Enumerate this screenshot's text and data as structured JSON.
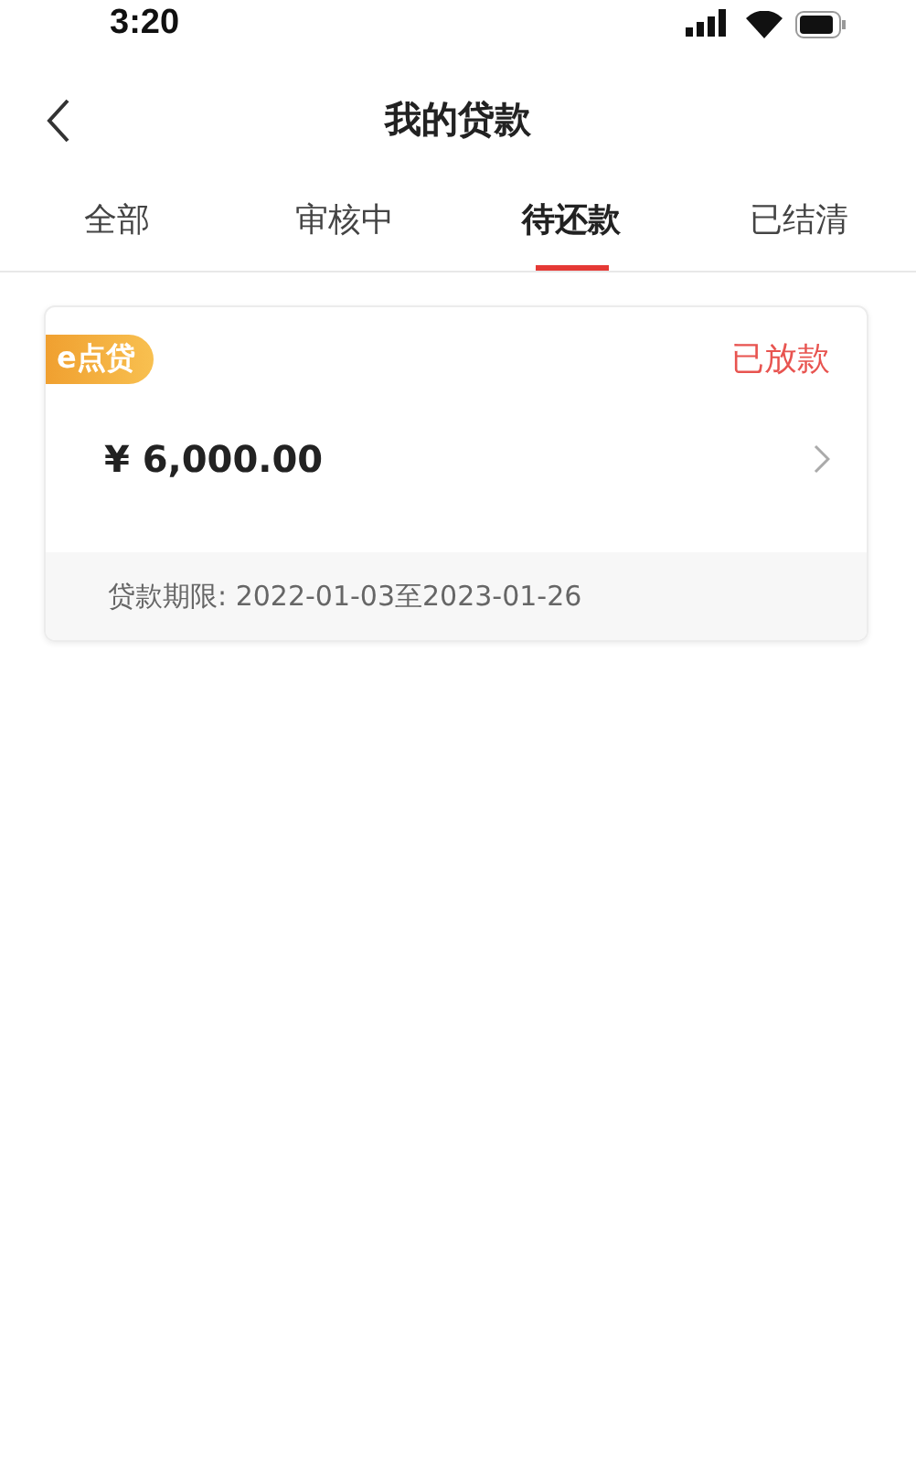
{
  "status_bar": {
    "time": "3:20"
  },
  "nav": {
    "title": "我的贷款"
  },
  "tabs": [
    {
      "label": "全部",
      "selected": false
    },
    {
      "label": "审核中",
      "selected": false
    },
    {
      "label": "待还款",
      "selected": true
    },
    {
      "label": "已结清",
      "selected": false
    }
  ],
  "loans": [
    {
      "badge": "e点贷",
      "status": "已放款",
      "amount": "¥ 6,000.00",
      "term": "贷款期限: 2022-01-03至2023-01-26"
    }
  ]
}
